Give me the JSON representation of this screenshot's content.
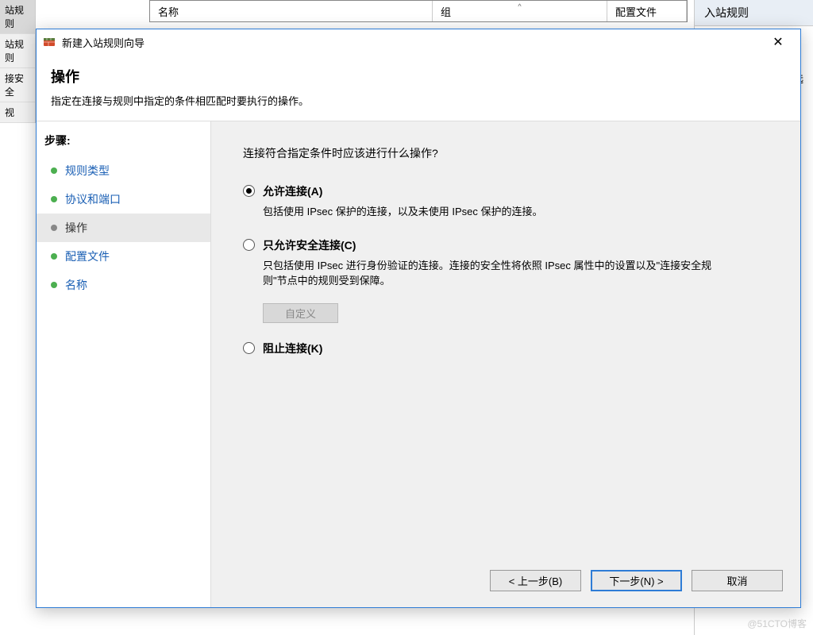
{
  "bg": {
    "nav_items": [
      "站规则",
      "站规则",
      "接安全",
      "视"
    ],
    "table_headers": {
      "name": "名称",
      "group": "组",
      "profile": "配置文件"
    },
    "right_panel": {
      "header": "入站规则",
      "item": "选"
    }
  },
  "dialog": {
    "title": "新建入站规则向导",
    "header_title": "操作",
    "header_subtitle": "指定在连接与规则中指定的条件相匹配时要执行的操作。",
    "steps_label": "步骤:",
    "steps": [
      {
        "label": "规则类型",
        "current": false
      },
      {
        "label": "协议和端口",
        "current": false
      },
      {
        "label": "操作",
        "current": true
      },
      {
        "label": "配置文件",
        "current": false
      },
      {
        "label": "名称",
        "current": false
      }
    ],
    "content": {
      "question": "连接符合指定条件时应该进行什么操作?",
      "options": [
        {
          "label": "允许连接(A)",
          "desc": "包括使用 IPsec 保护的连接，以及未使用 IPsec 保护的连接。",
          "checked": true
        },
        {
          "label": "只允许安全连接(C)",
          "desc": "只包括使用 IPsec 进行身份验证的连接。连接的安全性将依照 IPsec 属性中的设置以及\"连接安全规则\"节点中的规则受到保障。",
          "checked": false,
          "customize_btn": "自定义"
        },
        {
          "label": "阻止连接(K)",
          "desc": "",
          "checked": false
        }
      ]
    },
    "buttons": {
      "back": "< 上一步(B)",
      "next": "下一步(N) >",
      "cancel": "取消"
    }
  },
  "watermark": "@51CTO博客"
}
